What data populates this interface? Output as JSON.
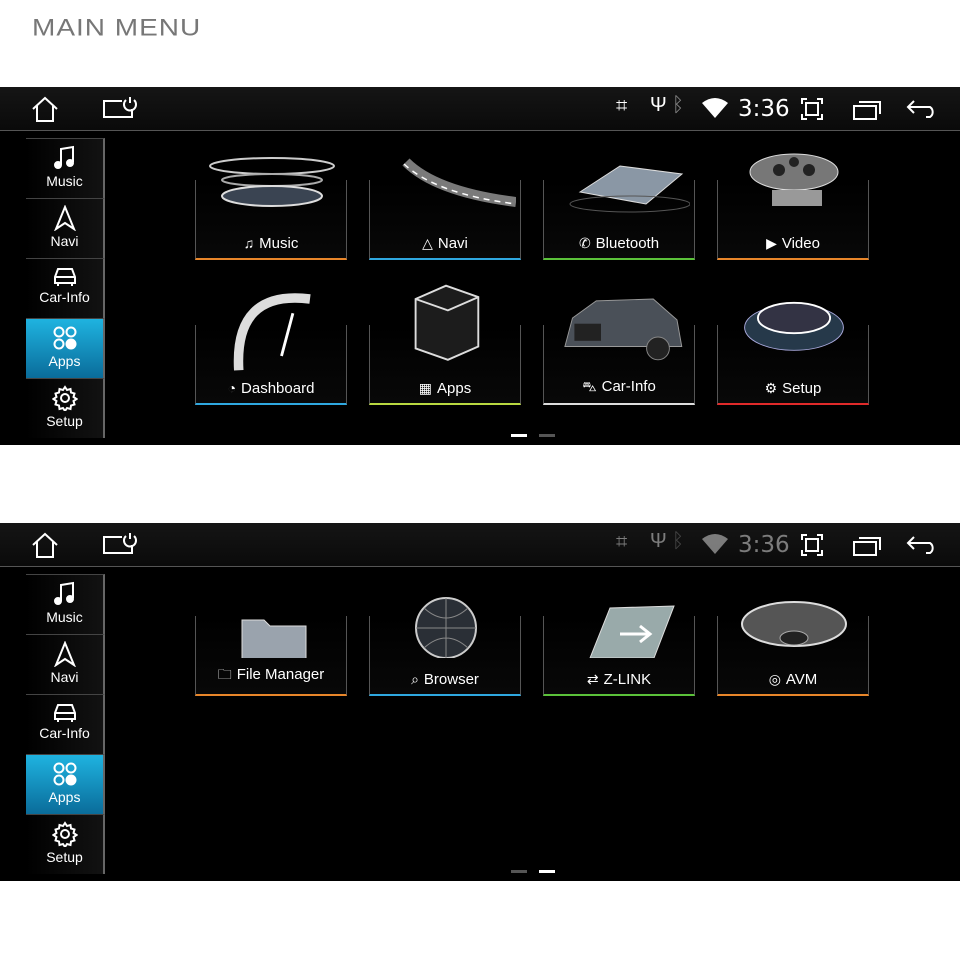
{
  "page_title": "MAIN MENU",
  "status": {
    "time": "3:36",
    "icons": [
      "cast-icon",
      "usb-icon",
      "bluetooth-icon",
      "wifi-icon"
    ],
    "buttons": [
      "fullscreen-icon",
      "recent-apps-icon",
      "back-icon"
    ]
  },
  "sidebar": [
    {
      "label": "Music",
      "icon": "music-note-icon"
    },
    {
      "label": "Navi",
      "icon": "navigation-arrow-icon"
    },
    {
      "label": "Car-Info",
      "icon": "car-icon"
    },
    {
      "label": "Apps",
      "icon": "apps-grid-icon",
      "active": true
    },
    {
      "label": "Setup",
      "icon": "gear-icon"
    }
  ],
  "screens": [
    {
      "page": 1,
      "page_count": 2,
      "tiles": [
        {
          "label": "Music",
          "glyph": "♫",
          "icon": "music-note-icon",
          "color": "#e8862a"
        },
        {
          "label": "Navi",
          "glyph": "△",
          "icon": "navigation-arrow-icon",
          "color": "#2fa8e0"
        },
        {
          "label": "Bluetooth",
          "glyph": "✆",
          "icon": "phone-icon",
          "color": "#5bc23a"
        },
        {
          "label": "Video",
          "glyph": "▶",
          "icon": "play-icon",
          "color": "#e8862a"
        },
        {
          "label": "Dashboard",
          "glyph": "◔",
          "icon": "speedometer-icon",
          "color": "#2fa8e0"
        },
        {
          "label": "Apps",
          "glyph": "▦",
          "icon": "apps-grid-icon",
          "color": "#b8d840"
        },
        {
          "label": "Car-Info",
          "glyph": "⛍",
          "icon": "car-icon",
          "color": "#dddddd"
        },
        {
          "label": "Setup",
          "glyph": "⚙",
          "icon": "gear-icon",
          "color": "#e02a2a"
        }
      ]
    },
    {
      "page": 2,
      "page_count": 2,
      "tiles": [
        {
          "label": "File Manager",
          "glyph": "🗀",
          "icon": "folder-icon",
          "color": "#e8862a"
        },
        {
          "label": "Browser",
          "glyph": "⌕",
          "icon": "search-icon",
          "color": "#2fa8e0"
        },
        {
          "label": "Z-LINK",
          "glyph": "⇄",
          "icon": "sync-icon",
          "color": "#5bc23a"
        },
        {
          "label": "AVM",
          "glyph": "◎",
          "icon": "camera-icon",
          "color": "#e8862a"
        }
      ]
    }
  ]
}
